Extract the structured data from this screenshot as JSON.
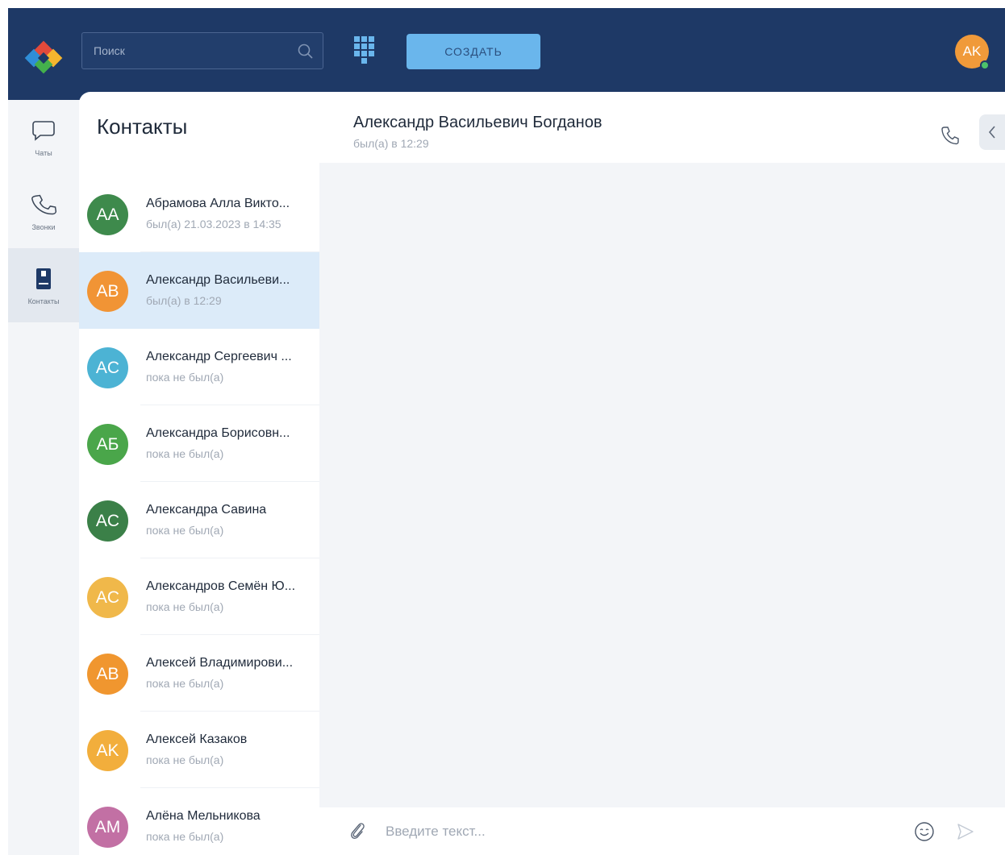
{
  "header": {
    "search": {
      "placeholder": "Поиск",
      "value": ""
    },
    "create_label": "СОЗДАТЬ",
    "user_initials": "AK"
  },
  "rail": {
    "items": [
      {
        "label": "Чаты",
        "icon": "chat-bubble-icon"
      },
      {
        "label": "Звонки",
        "icon": "phone-icon"
      },
      {
        "label": "Контакты",
        "icon": "contacts-book-icon",
        "active": true
      }
    ]
  },
  "contacts": {
    "title": "Контакты",
    "items": [
      {
        "initials": "AA",
        "name": "Абрамова Алла Викто...",
        "status": "был(а) 21.03.2023 в 14:35",
        "color": "#3e8a4c"
      },
      {
        "initials": "AB",
        "name": "Александр Васильеви...",
        "status": "был(а) в 12:29",
        "color": "#f19435",
        "selected": true
      },
      {
        "initials": "AC",
        "name": "Александр Сергеевич ...",
        "status": "пока не был(а)",
        "color": "#4cb3d4"
      },
      {
        "initials": "AБ",
        "name": "Александра Борисовн...",
        "status": "пока не был(а)",
        "color": "#4aa64a"
      },
      {
        "initials": "AC",
        "name": "Александра Савина",
        "status": "пока не был(а)",
        "color": "#3b8048"
      },
      {
        "initials": "AC",
        "name": "Александров Семён Ю...",
        "status": "пока не был(а)",
        "color": "#f0b84a"
      },
      {
        "initials": "AB",
        "name": "Алексей Владимирови...",
        "status": "пока не был(а)",
        "color": "#f0962f"
      },
      {
        "initials": "AK",
        "name": "Алексей Казаков",
        "status": "пока не был(а)",
        "color": "#f2ae3c"
      },
      {
        "initials": "AM",
        "name": "Алёна Мельникова",
        "status": "пока не был(а)",
        "color": "#c270a4"
      }
    ]
  },
  "chat": {
    "name": "Александр Васильевич Богданов",
    "status": "был(а) в 12:29",
    "input_placeholder": "Введите текст..."
  },
  "colors": {
    "header_bg": "#1e3966",
    "accent": "#6ab6ec",
    "selected_row": "#dcebf9"
  }
}
